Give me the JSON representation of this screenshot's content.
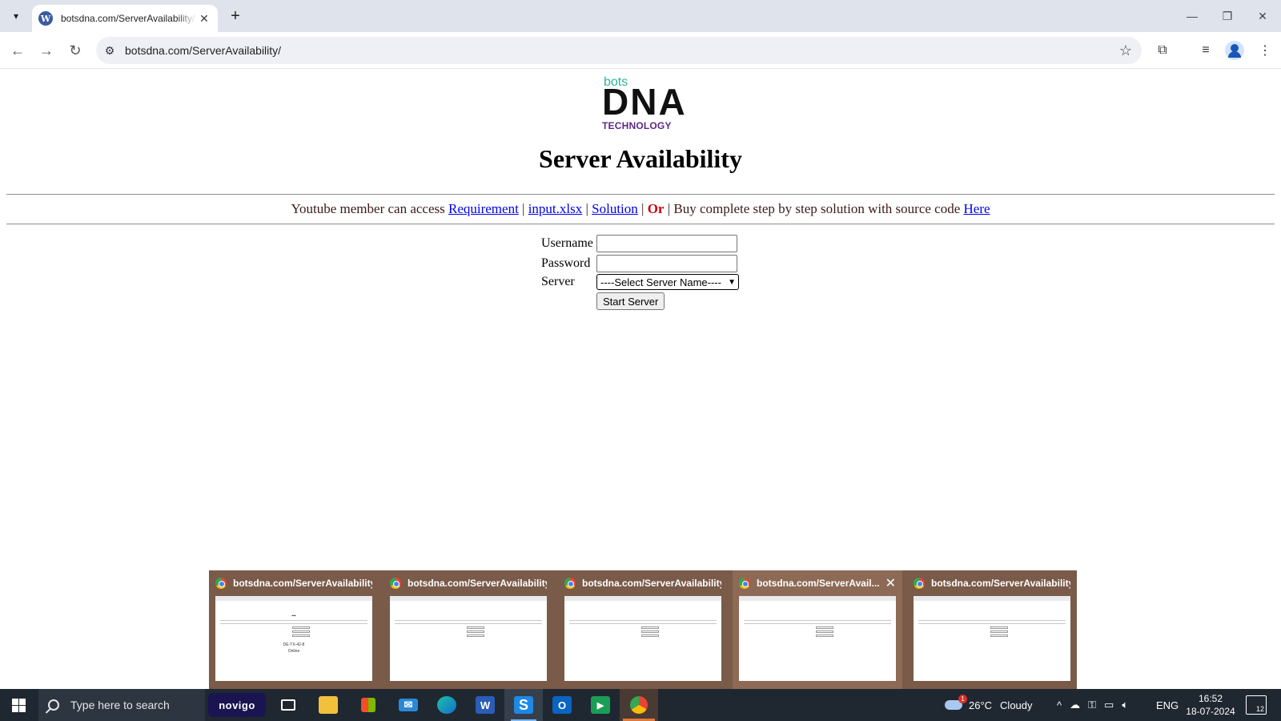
{
  "browser": {
    "tab_title": "botsdna.com/ServerAvailability/",
    "tab_favicon": "wordpress-icon",
    "url": "botsdna.com/ServerAvailability/"
  },
  "logo": {
    "bots": "bots",
    "dna": "DNA",
    "technology": "TECHNOLOGY"
  },
  "page": {
    "title": "Server Availability",
    "info_prefix": "Youtube member can access",
    "link_requirement": "Requirement",
    "link_input": "input.xlsx",
    "link_solution": "Solution",
    "separator": "|",
    "or_text": "Or",
    "buy_text": "Buy complete step by step solution with source code",
    "link_here": "Here"
  },
  "form": {
    "username_label": "Username",
    "username_value": "",
    "password_label": "Password",
    "password_value": "",
    "server_label": "Server",
    "server_selected": "----Select Server Name----",
    "start_button": "Start Server"
  },
  "previews": [
    {
      "title": "botsdna.com/ServerAvailability...",
      "extra_lines": [
        "DE-TX-42-8",
        "Online"
      ]
    },
    {
      "title": "botsdna.com/ServerAvailability...",
      "extra_lines": []
    },
    {
      "title": "botsdna.com/ServerAvailability...",
      "extra_lines": []
    },
    {
      "title": "botsdna.com/ServerAvail...",
      "extra_lines": [],
      "hovered": true
    },
    {
      "title": "botsdna.com/ServerAvailability...",
      "extra_lines": []
    }
  ],
  "taskbar": {
    "search_placeholder": "Type here to search",
    "novigo_label": "novigo",
    "weather_temp": "26°C",
    "weather_text": "Cloudy",
    "weather_badge": "1",
    "language": "ENG",
    "time": "16:52",
    "date": "18-07-2024",
    "notifications": "12"
  }
}
